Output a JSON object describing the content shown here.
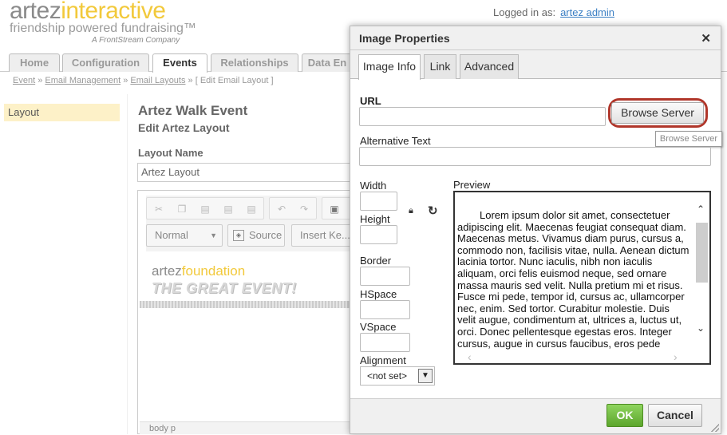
{
  "header": {
    "logo_part1": "artez",
    "logo_part2": "interactive",
    "tagline": "friendship powered fundraising™",
    "company": "A FrontStream Company",
    "logged_in_label": "Logged in as:",
    "user_link": "artez admin"
  },
  "tabs": [
    "Home",
    "Configuration",
    "Events",
    "Relationships",
    "Data En"
  ],
  "breadcrumb": {
    "items": [
      "Event",
      "Email Management",
      "Email Layouts"
    ],
    "current": "[ Edit Email Layout ]"
  },
  "sidebar": {
    "items": [
      {
        "label": "Layout"
      }
    ]
  },
  "main": {
    "event_title": "Artez Walk Event",
    "subtitle": "Edit Artez Layout",
    "layout_name_label": "Layout Name",
    "layout_name_value": "Artez Layout"
  },
  "editor": {
    "format_value": "Normal",
    "source_label": "Source",
    "insert_label": "Insert Ke...",
    "content_line1_a": "artez",
    "content_line1_b": "foundation",
    "content_line2": "THE GREAT EVENT!",
    "status_path": "body   p"
  },
  "dialog": {
    "title": "Image Properties",
    "tabs": [
      "Image Info",
      "Link",
      "Advanced"
    ],
    "url_label": "URL",
    "url_value": "",
    "browse_label": "Browse Server",
    "tooltip": "Browse Server",
    "alt_label": "Alternative Text",
    "alt_value": "",
    "width_label": "Width",
    "height_label": "Height",
    "border_label": "Border",
    "hspace_label": "HSpace",
    "vspace_label": "VSpace",
    "alignment_label": "Alignment",
    "alignment_value": "<not set>",
    "preview_label": "Preview",
    "preview_text": "Lorem ipsum dolor sit amet, consectetuer adipiscing elit. Maecenas feugiat consequat diam. Maecenas metus. Vivamus diam purus, cursus a, commodo non, facilisis vitae, nulla. Aenean dictum lacinia tortor. Nunc iaculis, nibh non iaculis aliquam, orci felis euismod neque, sed ornare massa mauris sed velit. Nulla pretium mi et risus. Fusce mi pede, tempor id, cursus ac, ullamcorper nec, enim. Sed tortor. Curabitur molestie. Duis velit augue, condimentum at, ultrices a, luctus ut, orci. Donec pellentesque egestas eros. Integer cursus, augue in cursus faucibus, eros pede bibendum sem, in",
    "ok_label": "OK",
    "cancel_label": "Cancel"
  },
  "colors": {
    "brand_yellow": "#f2c93b",
    "highlight_red": "#b0362a",
    "ok_green": "#5ca52c"
  }
}
